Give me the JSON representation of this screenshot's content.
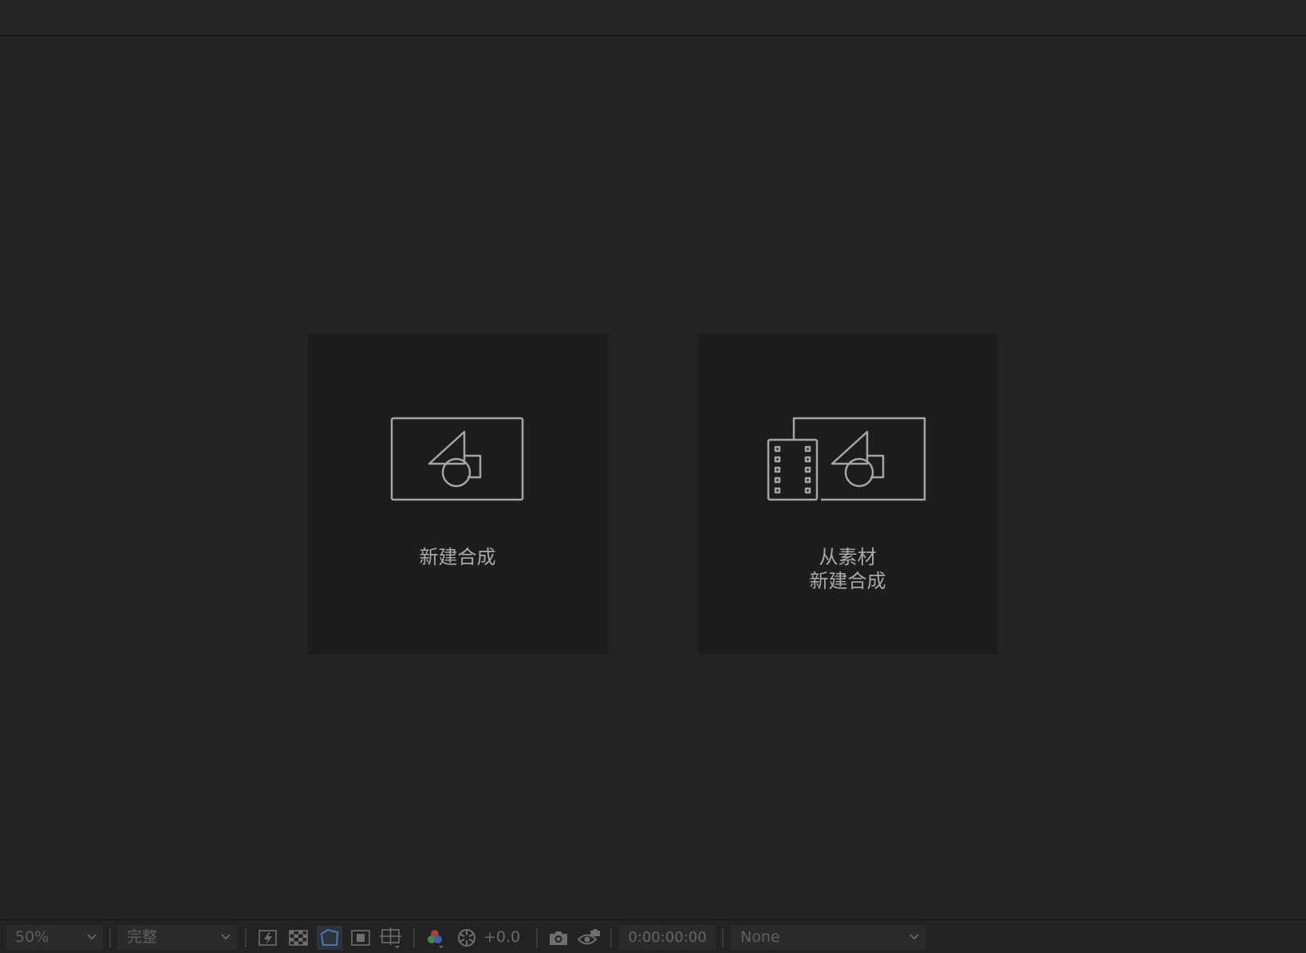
{
  "viewer": {
    "cards": [
      {
        "label": "新建合成"
      },
      {
        "label": "从素材\n新建合成"
      }
    ]
  },
  "bottombar": {
    "zoom": "50%",
    "resolution": "完整",
    "exposure": "+0.0",
    "timecode": "0:00:00:00",
    "view_option": "None",
    "icons": [
      "fast-preview-icon",
      "transparency-grid-icon",
      "mask-path-visibility-icon",
      "region-of-interest-icon",
      "grid-guides-icon",
      "color-channels-icon",
      "exposure-reset-icon",
      "snapshot-icon",
      "show-snapshot-icon"
    ]
  }
}
